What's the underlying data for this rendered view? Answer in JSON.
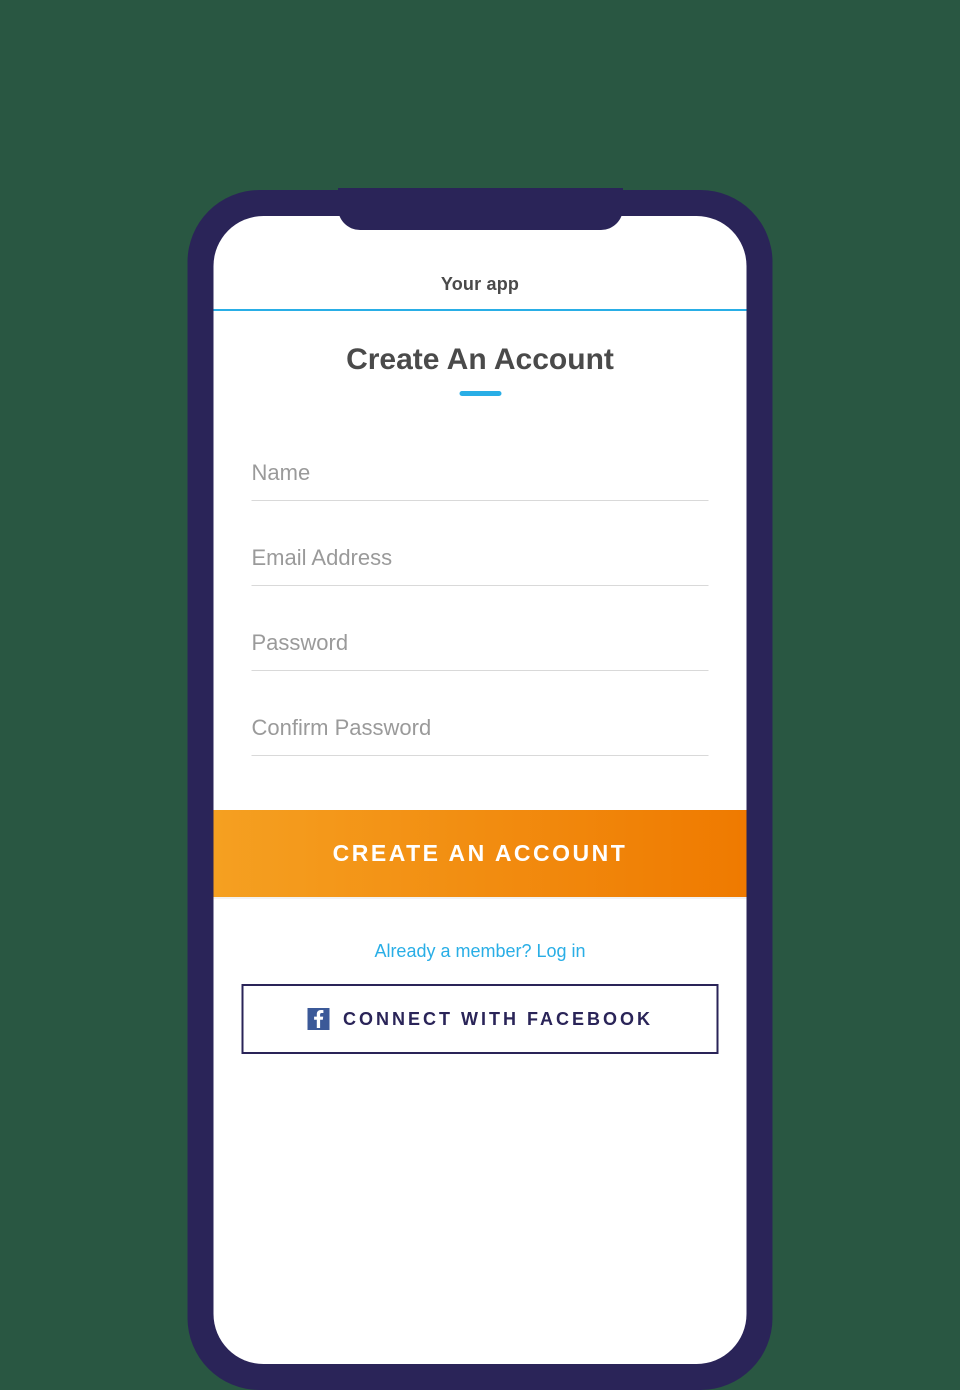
{
  "header": {
    "app_title": "Your app"
  },
  "page": {
    "heading": "Create An Account"
  },
  "form": {
    "name_placeholder": "Name",
    "email_placeholder": "Email Address",
    "password_placeholder": "Password",
    "confirm_password_placeholder": "Confirm Password",
    "submit_label": "CREATE AN ACCOUNT"
  },
  "links": {
    "login_text": "Already a member? Log in"
  },
  "social": {
    "facebook_label": "CONNECT WITH FACEBOOK"
  },
  "colors": {
    "accent": "#29aee6",
    "primary_button_start": "#f5a021",
    "primary_button_end": "#ef7a00",
    "phone_frame": "#2a2458",
    "fb_brand": "#3b5998",
    "page_bg": "#295742"
  }
}
